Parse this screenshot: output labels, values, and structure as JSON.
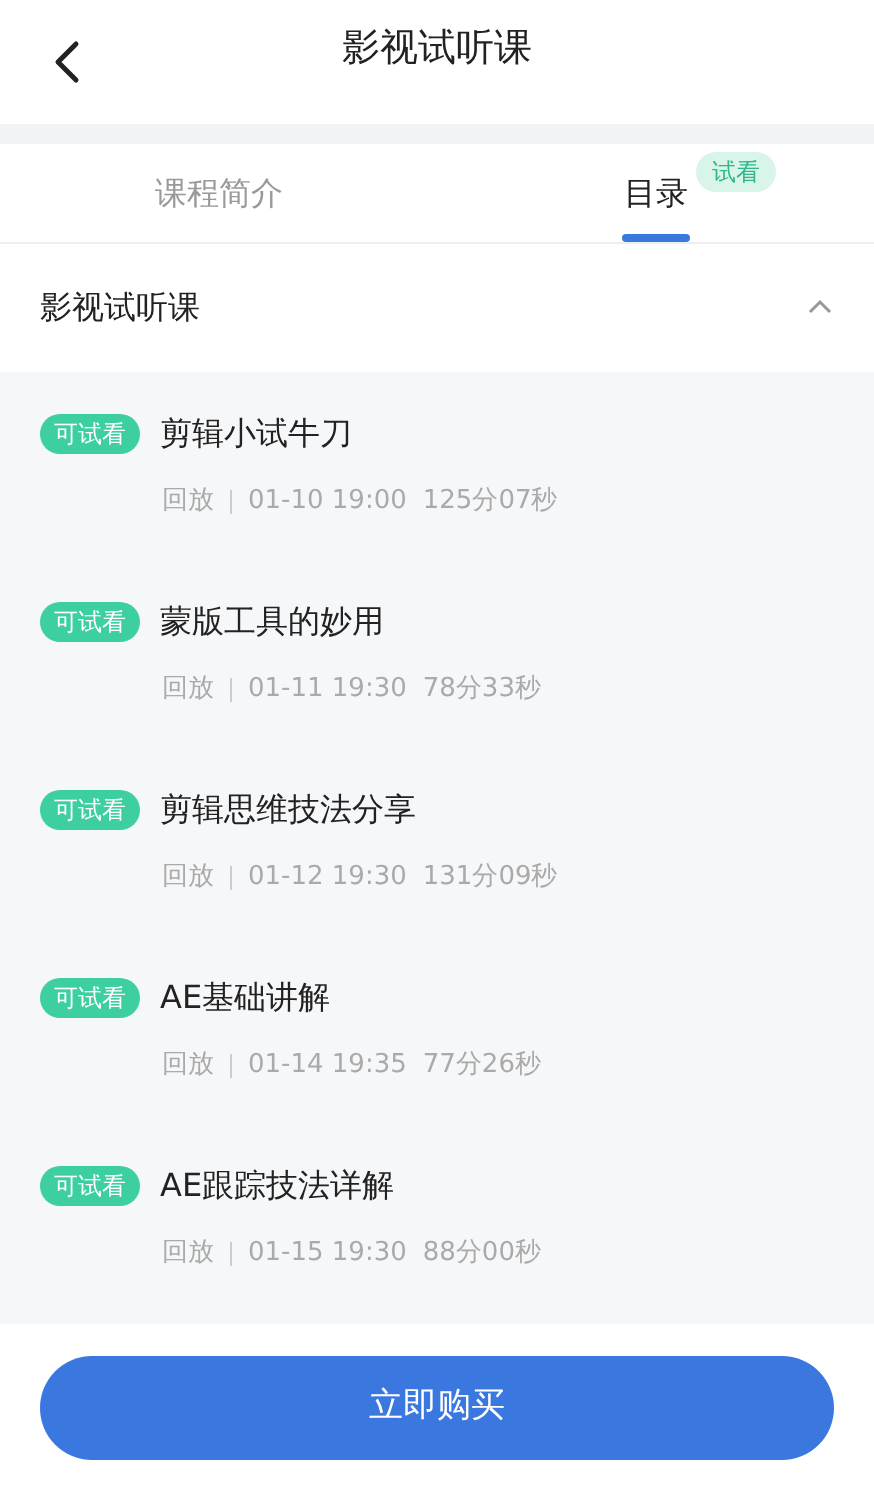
{
  "header": {
    "title": "影视试听课"
  },
  "tabs": [
    {
      "label": "课程简介",
      "selected": false
    },
    {
      "label": "目录",
      "selected": true,
      "badge": "试看"
    }
  ],
  "section": {
    "title": "影视试听课",
    "expanded": true
  },
  "lessons": [
    {
      "tag": "可试看",
      "title": "剪辑小试牛刀",
      "type": "回放",
      "time": "01-10 19:00",
      "duration": "125分07秒"
    },
    {
      "tag": "可试看",
      "title": "蒙版工具的妙用",
      "type": "回放",
      "time": "01-11 19:30",
      "duration": "78分33秒"
    },
    {
      "tag": "可试看",
      "title": "剪辑思维技法分享",
      "type": "回放",
      "time": "01-12 19:30",
      "duration": "131分09秒"
    },
    {
      "tag": "可试看",
      "title": "AE基础讲解",
      "type": "回放",
      "time": "01-14 19:35",
      "duration": "77分26秒"
    },
    {
      "tag": "可试看",
      "title": "AE跟踪技法详解",
      "type": "回放",
      "time": "01-15 19:30",
      "duration": "88分00秒"
    }
  ],
  "buy_button": "立即购买"
}
